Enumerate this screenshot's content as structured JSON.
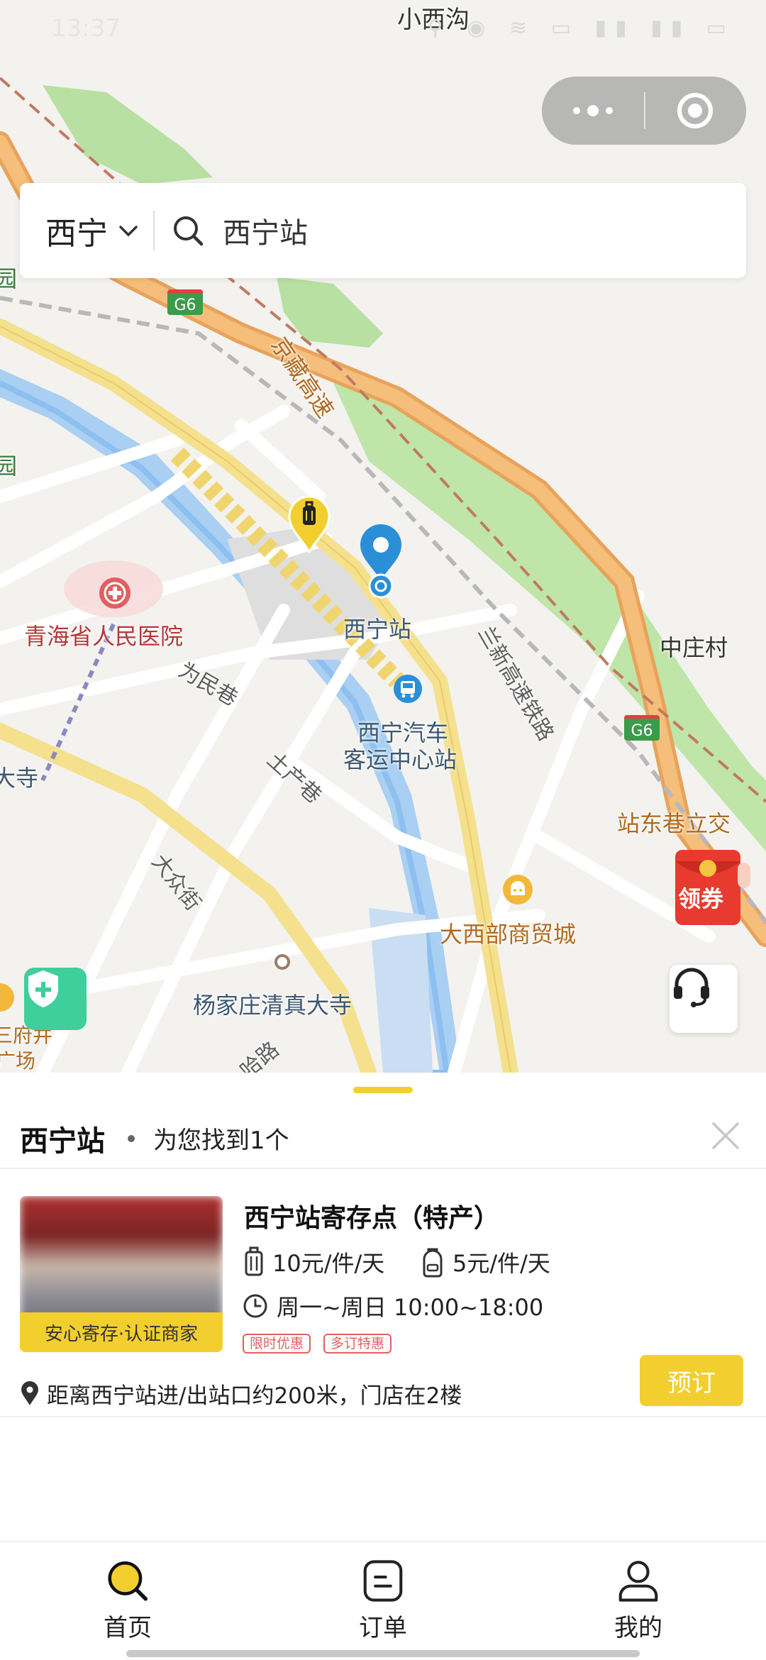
{
  "status_bar": {
    "time": "13:37",
    "icons": "⚲ ◉ ≋ ▭ ▮▮ ▮▮ ▭"
  },
  "map": {
    "labels": {
      "top_village": "小西沟",
      "hospital": "青海省人民医院",
      "station": "西宁站",
      "bus_station_line1": "西宁汽车",
      "bus_station_line2": "客运中心站",
      "weimin_lane": "为民巷",
      "tuchan_lane": "土产巷",
      "dazhong_street": "大众街",
      "mosque": "杨家庄清真大寺",
      "mall": "大西部商贸城",
      "village_east": "中庄村",
      "zhandong_lane": "站东巷立交",
      "expressway": "京藏高速",
      "railway": "兰新高速铁路",
      "g6_1": "G6",
      "g6_2": "G6",
      "edge_temple": "大寺",
      "edge_square_1": "三府井",
      "edge_square_2": "广场",
      "edge_park_1": "园",
      "edge_park_2": "园",
      "road_bottom": "哈路",
      "voucher_label": "领券"
    }
  },
  "search": {
    "city": "西宁",
    "query": "西宁站"
  },
  "results": {
    "place": "西宁站",
    "count_text": "为您找到1个"
  },
  "store": {
    "name": "西宁站寄存点（特产）",
    "badge": "安心寄存·认证商家",
    "price_luggage": "10元/件/天",
    "price_bag": "5元/件/天",
    "hours": "周一~周日 10:00~18:00",
    "tags": [
      "限时优惠",
      "多订特惠"
    ],
    "location_note": "距离西宁站进/出站口约200米，门店在2楼",
    "book_label": "预订"
  },
  "tabs": [
    {
      "label": "首页",
      "icon": "home-search-icon",
      "active": true
    },
    {
      "label": "订单",
      "icon": "order-icon",
      "active": false
    },
    {
      "label": "我的",
      "icon": "user-icon",
      "active": false
    }
  ],
  "colors": {
    "accent": "#f2cf2f",
    "pin_blue": "#2a8fd6",
    "shield_green": "#3fcf9c",
    "promo_red": "#e06060"
  }
}
